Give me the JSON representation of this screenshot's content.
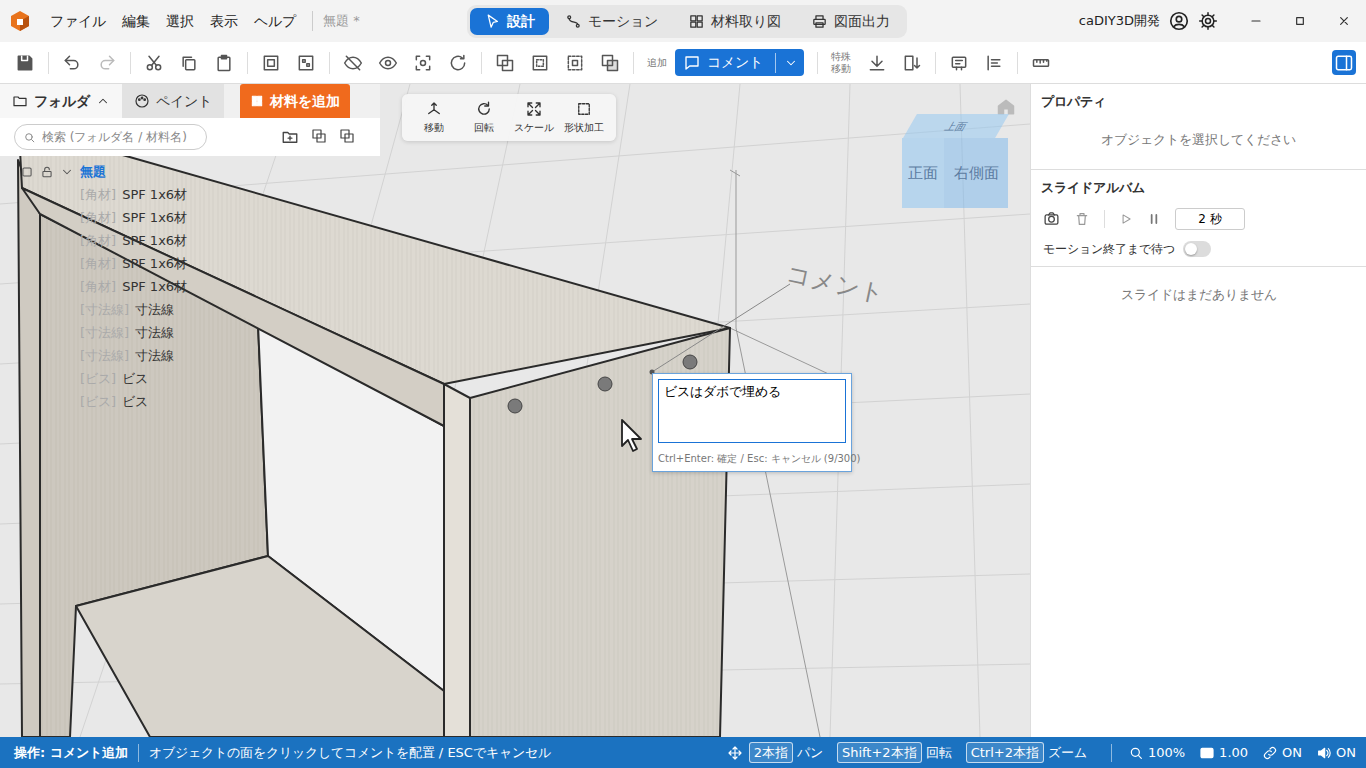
{
  "window": {
    "title": "無題 *",
    "app_name": "caDIY3D開発"
  },
  "menu": [
    "ファイル",
    "編集",
    "選択",
    "表示",
    "ヘルプ"
  ],
  "modes": [
    {
      "label": "設計",
      "selected": true
    },
    {
      "label": "モーション",
      "selected": false
    },
    {
      "label": "材料取り図",
      "selected": false
    },
    {
      "label": "図面出力",
      "selected": false
    }
  ],
  "toolbar": {
    "undo_disabled": false,
    "redo_disabled": true,
    "add_label": "追加",
    "comment_button": "コメント",
    "special_move_label": [
      "特殊",
      "移動"
    ],
    "panel_open": true
  },
  "left_panel": {
    "tabs": [
      {
        "label": "フォルダ",
        "selected": true
      },
      {
        "label": "ペイント",
        "selected": false
      }
    ],
    "add_material": "材料を追加",
    "search_placeholder": "検索 (フォルダ名 / 材料名)",
    "tree": {
      "root": "無題",
      "expanded": true,
      "items": [
        {
          "tag": "[角材]",
          "name": "SPF 1x6材"
        },
        {
          "tag": "[角材]",
          "name": "SPF 1x6材"
        },
        {
          "tag": "[角材]",
          "name": "SPF 1x6材"
        },
        {
          "tag": "[角材]",
          "name": "SPF 1x6材"
        },
        {
          "tag": "[角材]",
          "name": "SPF 1x6材"
        },
        {
          "tag": "[寸法線]",
          "name": "寸法線"
        },
        {
          "tag": "[寸法線]",
          "name": "寸法線"
        },
        {
          "tag": "[寸法線]",
          "name": "寸法線"
        },
        {
          "tag": "[ビス]",
          "name": "ビス"
        },
        {
          "tag": "[ビス]",
          "name": "ビス"
        }
      ]
    }
  },
  "tools": [
    "移動",
    "回転",
    "スケール",
    "形状加工"
  ],
  "view_cube": {
    "top": "上面",
    "front": "正面",
    "right": "右側面"
  },
  "scene": {
    "comment_label": "コメント"
  },
  "comment_editor": {
    "value": "ビスはダボで埋める",
    "hint": "Ctrl+Enter: 確定 / Esc: キャンセル (9/300)"
  },
  "properties": {
    "title": "プロパティ",
    "empty": "オブジェクトを選択してください"
  },
  "slide_album": {
    "title": "スライドアルバム",
    "interval": "2 秒",
    "wait_label": "モーション終了まで待つ",
    "wait_on": false,
    "empty": "スライドはまだありません"
  },
  "status_bar": {
    "operation": "操作: コメント追加",
    "hint": "オブジェクトの面をクリックしてコメントを配置 / ESCでキャンセル",
    "controls": [
      {
        "key": "2本指",
        "action": "パン"
      },
      {
        "key": "Shift+2本指",
        "action": "回転"
      },
      {
        "key": "Ctrl+2本指",
        "action": "ズーム"
      }
    ],
    "zoom": "100%",
    "scale": "1.00",
    "link": "ON",
    "sound": "ON"
  }
}
